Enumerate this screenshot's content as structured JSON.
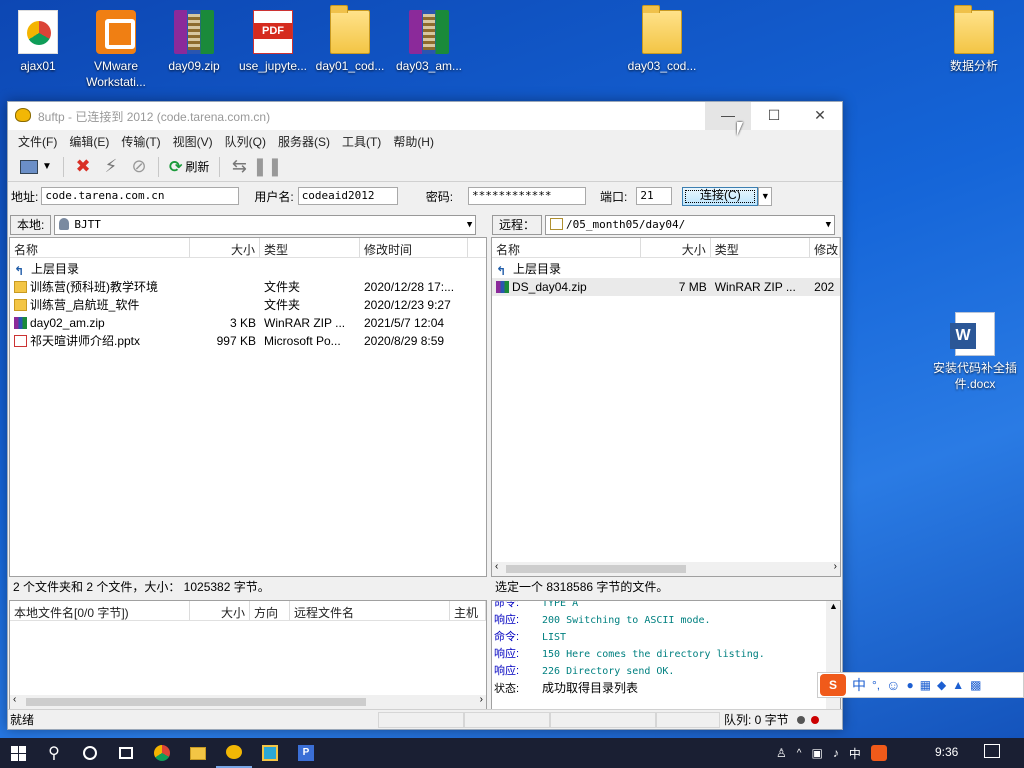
{
  "desktop": {
    "icons": [
      {
        "label": "ajax01",
        "type": "chrome-folder"
      },
      {
        "label": "VMware Workstati...",
        "type": "vmware"
      },
      {
        "label": "day09.zip",
        "type": "rar"
      },
      {
        "label": "use_jupyte...",
        "type": "pdf"
      },
      {
        "label": "day01_cod...",
        "type": "folder"
      },
      {
        "label": "day03_am...",
        "type": "rar"
      },
      {
        "label": "day03_cod...",
        "type": "folder"
      },
      {
        "label": "数据分析",
        "type": "folder"
      },
      {
        "label": "安装代码补全插件.docx",
        "type": "word"
      }
    ],
    "pdf_badge": "PDF",
    "word_badge": "W"
  },
  "window": {
    "title": "8uftp - 已连接到 2012 (code.tarena.com.cn)",
    "minimize": "—",
    "maximize": "☐",
    "close": "✕",
    "menu": [
      "文件(F)",
      "编辑(E)",
      "传输(T)",
      "视图(V)",
      "队列(Q)",
      "服务器(S)",
      "工具(T)",
      "帮助(H)"
    ],
    "toolbar": {
      "refresh_label": "刷新"
    },
    "address": {
      "addr_label": "地址:",
      "addr_value": "code.tarena.com.cn",
      "user_label": "用户名:",
      "user_value": "codeaid2012",
      "pass_label": "密码:",
      "pass_value": "************",
      "port_label": "端口:",
      "port_value": "21",
      "connect_label": "连接(C)"
    }
  },
  "local": {
    "path_label": "本地:",
    "path_value": "BJTT",
    "columns": [
      "名称",
      "大小",
      "类型",
      "修改时间"
    ],
    "rows": [
      {
        "name": "上层目录",
        "size": "",
        "type": "",
        "date": "",
        "icon": "up"
      },
      {
        "name": "训练营(预科班)教学环境",
        "size": "",
        "type": "文件夹",
        "date": "2020/12/28 17:...",
        "icon": "folder"
      },
      {
        "name": "训练营_启航班_软件",
        "size": "",
        "type": "文件夹",
        "date": "2020/12/23 9:27",
        "icon": "folder"
      },
      {
        "name": "day02_am.zip",
        "size": "3 KB",
        "type": "WinRAR ZIP ...",
        "date": "2021/5/7 12:04",
        "icon": "rar"
      },
      {
        "name": "祁天暄讲师介绍.pptx",
        "size": "997 KB",
        "type": "Microsoft Po...",
        "date": "2020/8/29 8:59",
        "icon": "ppt"
      }
    ],
    "status": "2 个文件夹和 2 个文件，大小：  1025382 字节。"
  },
  "remote": {
    "path_label": "远程：",
    "path_value": "/05_month05/day04/",
    "columns": [
      "名称",
      "大小",
      "类型",
      "修改"
    ],
    "rows": [
      {
        "name": "上层目录",
        "size": "",
        "type": "",
        "date": "",
        "icon": "up"
      },
      {
        "name": "DS_day04.zip",
        "size": "7 MB",
        "type": "WinRAR ZIP ...",
        "date": "202",
        "icon": "rar",
        "selected": true
      }
    ],
    "status": "选定一个 8318586 字节的文件。"
  },
  "queue": {
    "columns": [
      "本地文件名[0/0 字节])",
      "大小",
      "方向",
      "远程文件名",
      "主机"
    ]
  },
  "log": [
    {
      "k": "命令:",
      "v": "TYPE A"
    },
    {
      "k": "响应:",
      "v": "200 Switching to ASCII mode."
    },
    {
      "k": "命令:",
      "v": "LIST"
    },
    {
      "k": "响应:",
      "v": "150 Here comes the directory listing."
    },
    {
      "k": "响应:",
      "v": "226 Directory send OK."
    },
    {
      "k": "状态:",
      "v": "成功取得目录列表"
    }
  ],
  "statusbar": {
    "left": "就绪",
    "queue": "队列: 0 字节"
  },
  "ime": {
    "lang": "中",
    "punct": "°,"
  },
  "taskbar": {
    "time": "9:36",
    "ime": "中"
  },
  "colors": {
    "desktop": "#1565d8",
    "taskbar": "#1a1f33",
    "log_key": "#0000c0",
    "log_value": "#008080"
  }
}
